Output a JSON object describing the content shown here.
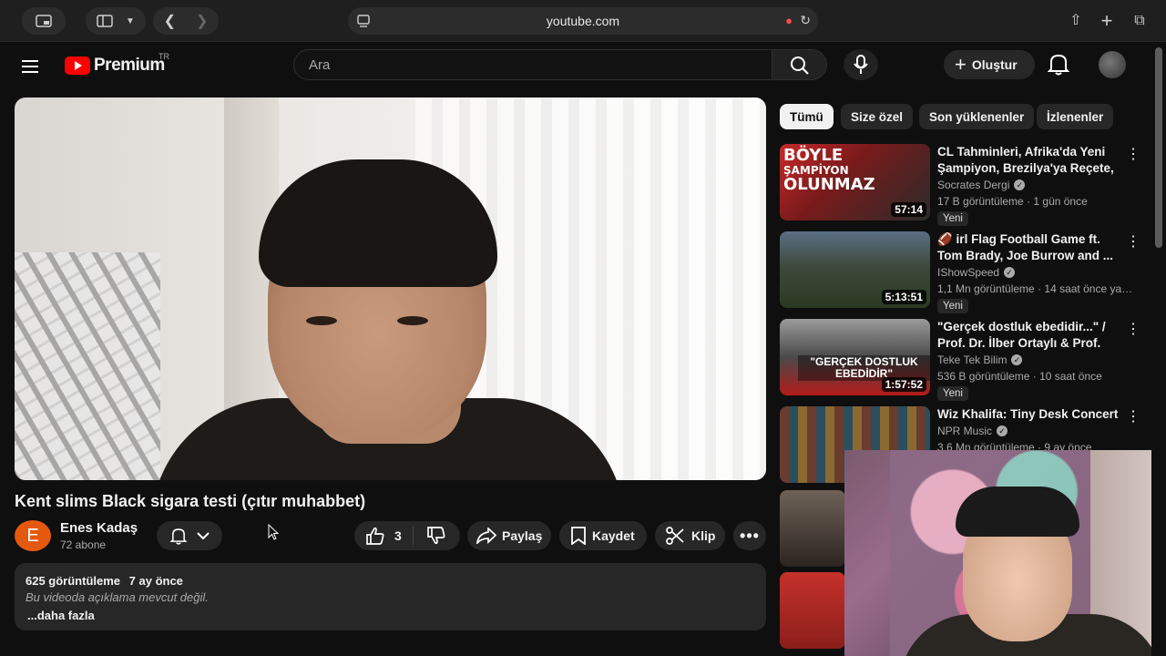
{
  "browser": {
    "url": "youtube.com"
  },
  "header": {
    "logo_text": "Premium",
    "logo_region": "TR",
    "search_placeholder": "Ara",
    "create_label": "Oluştur"
  },
  "video": {
    "title": "Kent slims Black sigara testi (çıtır muhabbet)",
    "channel_initial": "E",
    "channel_name": "Enes Kadaş",
    "subscribers": "72 abone",
    "like_count": "3",
    "share_label": "Paylaş",
    "save_label": "Kaydet",
    "clip_label": "Klip",
    "views": "625 görüntüleme",
    "date": "7 ay önce",
    "description": "Bu videoda açıklama mevcut değil.",
    "more_label": "...daha fazla"
  },
  "chips": [
    "Tümü",
    "Size özel",
    "Son yüklenenler",
    "İzlenenler"
  ],
  "recommendations": [
    {
      "title": "CL Tahminleri, Afrika'da Yeni Şampiyon, Brezilya'ya Reçete, ...",
      "channel": "Socrates Dergi",
      "verified": true,
      "meta": "17 B görüntüleme · 1 gün önce",
      "badge": "Yeni",
      "duration": "57:14",
      "thumb_text_1": "BÖYLE",
      "thumb_text_2": "ŞAMPİYON",
      "thumb_text_3": "OLUNMAZ"
    },
    {
      "title": "🏈 irl Flag Football Game ft. Tom Brady, Joe Burrow and ...",
      "channel": "IShowSpeed",
      "verified": true,
      "meta": "1,1 Mn görüntüleme · 14 saat önce yayın...",
      "badge": "Yeni",
      "duration": "5:13:51"
    },
    {
      "title": "\"Gerçek dostluk ebedidir...\" / Prof. Dr. İlber Ortaylı & Prof. Dr...",
      "channel": "Teke Tek Bilim",
      "verified": true,
      "meta": "536 B görüntüleme · 10 saat önce",
      "badge": "Yeni",
      "duration": "1:57:52",
      "thumb_caption": "\"GERÇEK DOSTLUK EBEDİDİR\""
    },
    {
      "title": "Wiz Khalifa: Tiny Desk Concert",
      "channel": "NPR Music",
      "verified": true,
      "meta": "3,6 Mn görüntüleme · 9 ay önce"
    }
  ]
}
